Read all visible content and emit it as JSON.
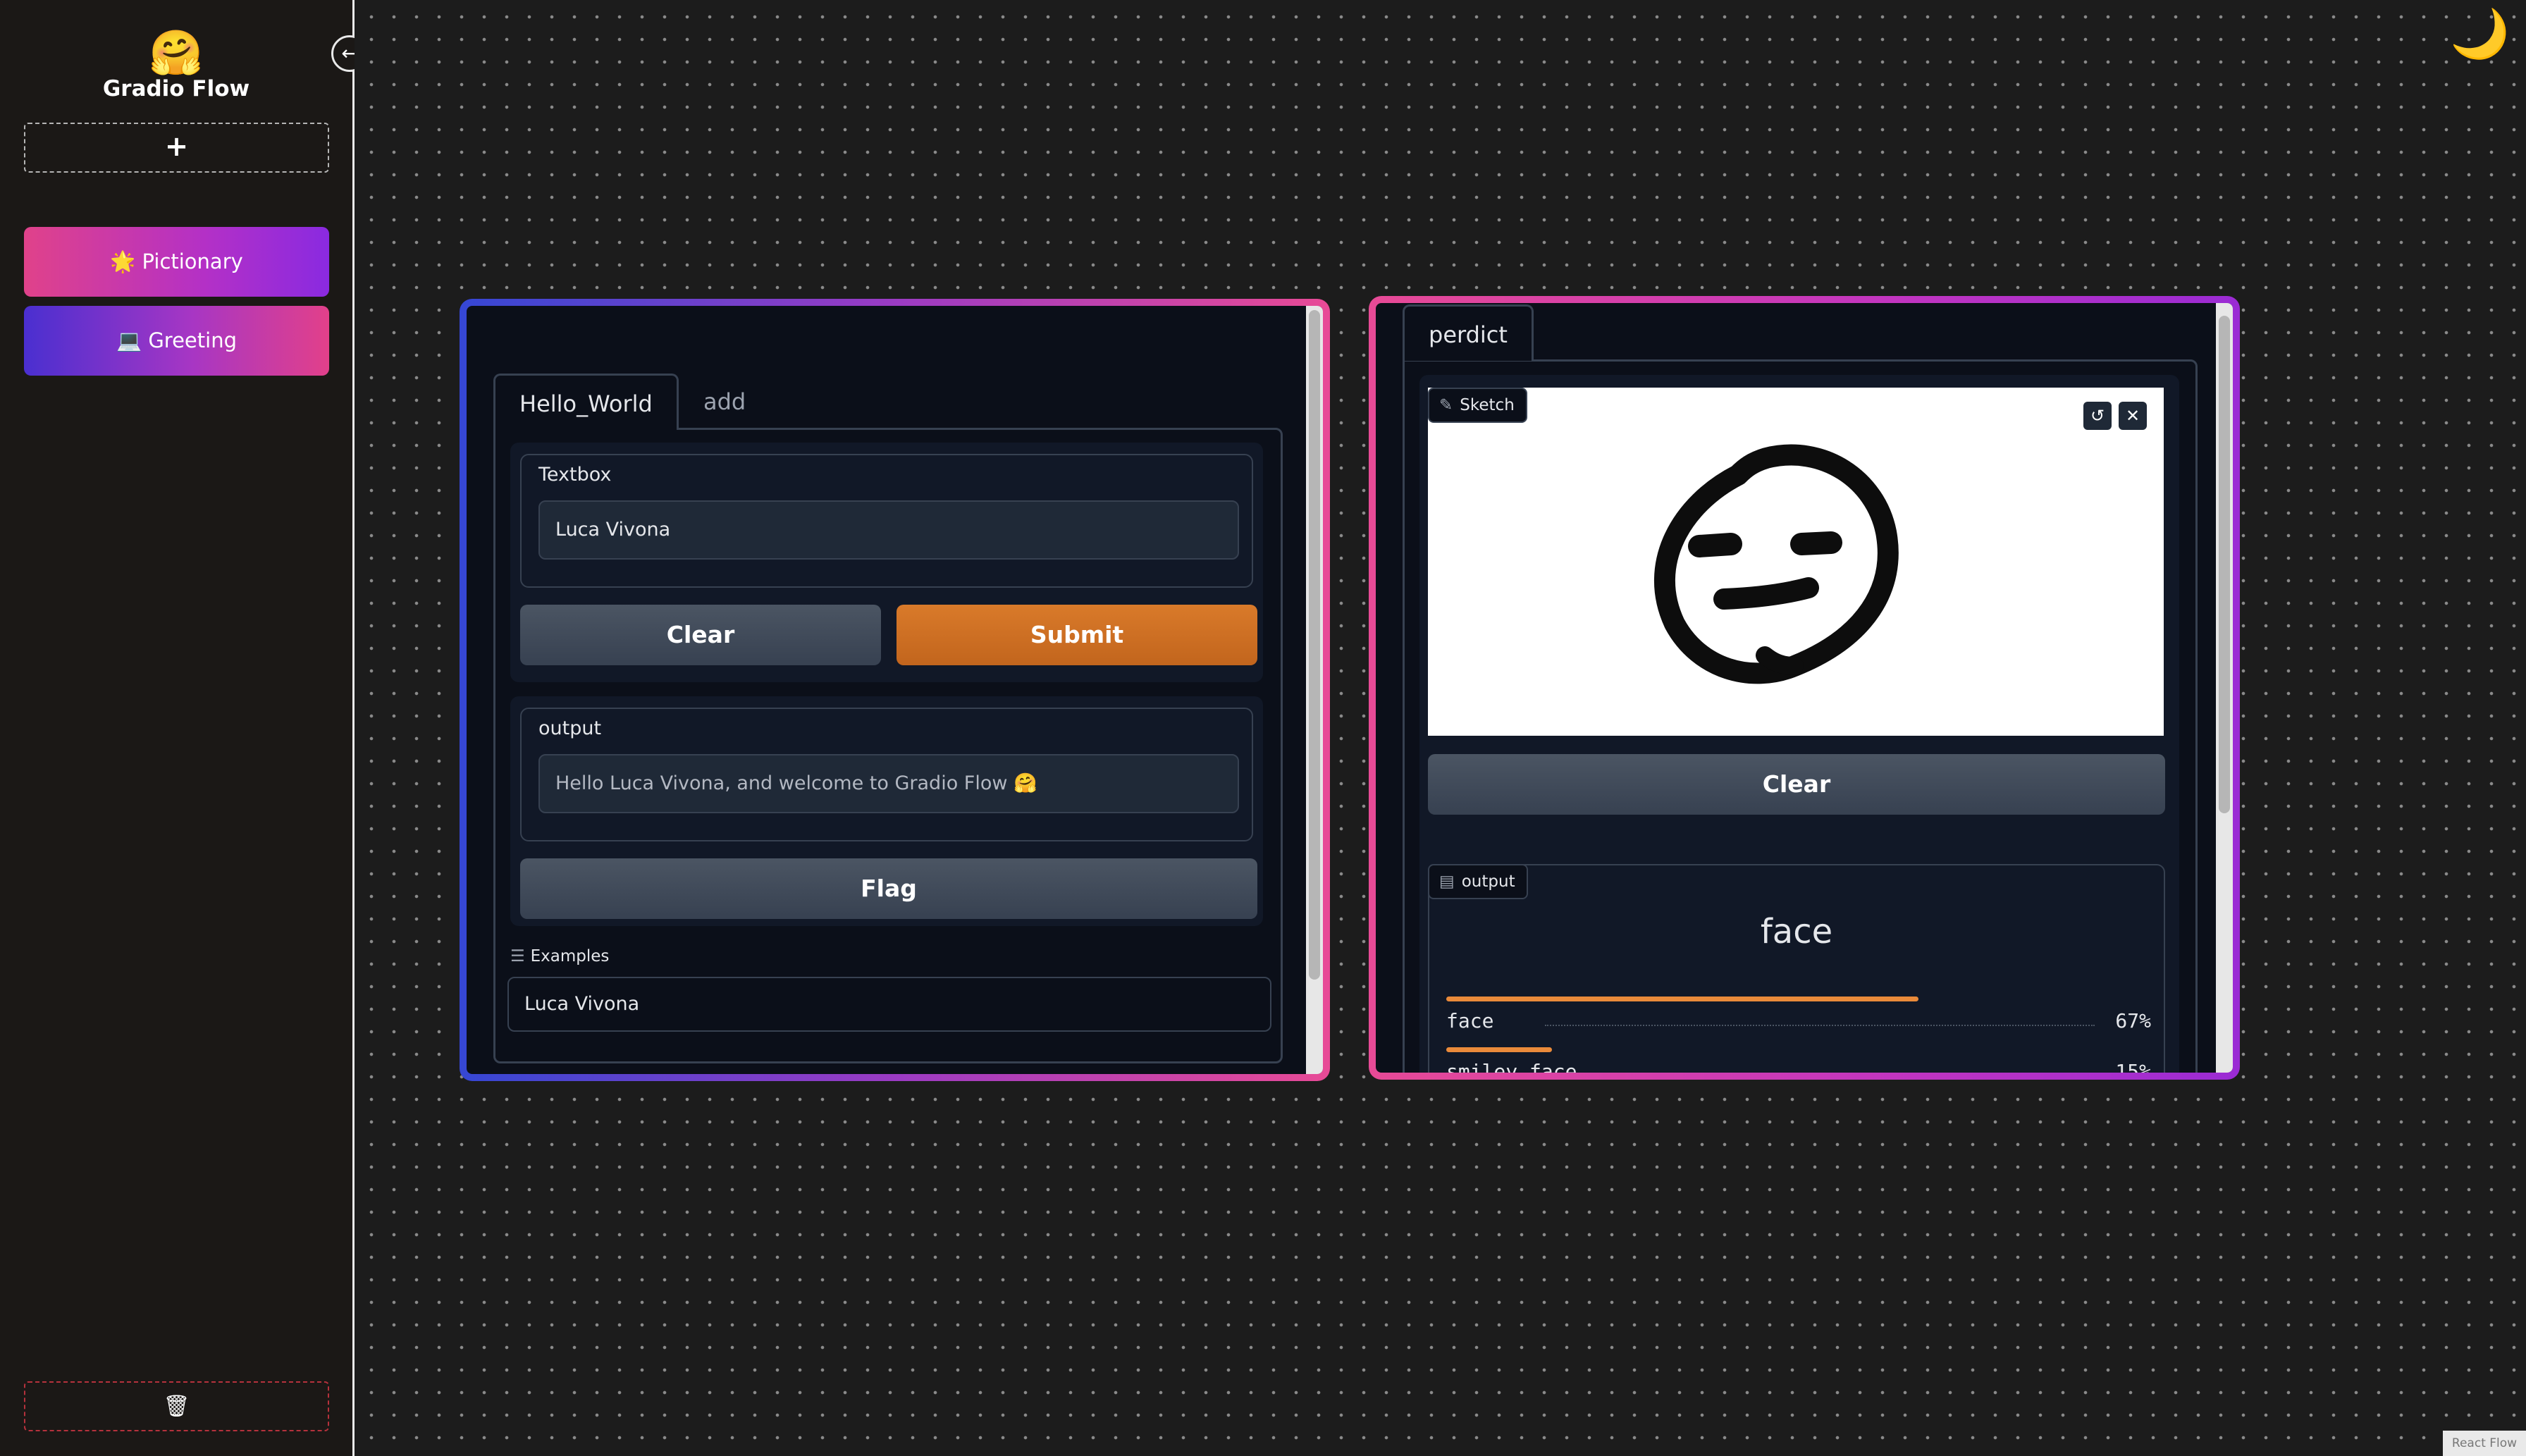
{
  "sidebar": {
    "logo_emoji": "🤗",
    "title": "Gradio Flow",
    "add_label": "+",
    "flows": [
      {
        "emoji": "🌟",
        "label": "Pictionary"
      },
      {
        "emoji": "💻",
        "label": "Greeting"
      }
    ],
    "trash_label": "🗑",
    "collapse_icon": "←"
  },
  "canvas": {
    "theme_icon": "🌙",
    "attribution": "React Flow"
  },
  "node_hello": {
    "tabs": [
      "Hello_World",
      "add"
    ],
    "active_tab": "Hello_World",
    "input_label": "Textbox",
    "input_value": "Luca Vivona",
    "clear_label": "Clear",
    "submit_label": "Submit",
    "output_label": "output",
    "output_value": "Hello Luca Vivona, and welcome to Gradio Flow 🤗",
    "flag_label": "Flag",
    "examples_label": "Examples",
    "examples": [
      "Luca Vivona"
    ]
  },
  "node_pictionary": {
    "tabs": [
      "perdict"
    ],
    "sketch_label": "Sketch",
    "clear_label": "Clear",
    "output_label": "output",
    "top_label": "face",
    "confidences": [
      {
        "label": "face",
        "percent": "67%",
        "value": 0.67
      },
      {
        "label": "smiley_face",
        "percent": "15%",
        "value": 0.15
      }
    ]
  }
}
